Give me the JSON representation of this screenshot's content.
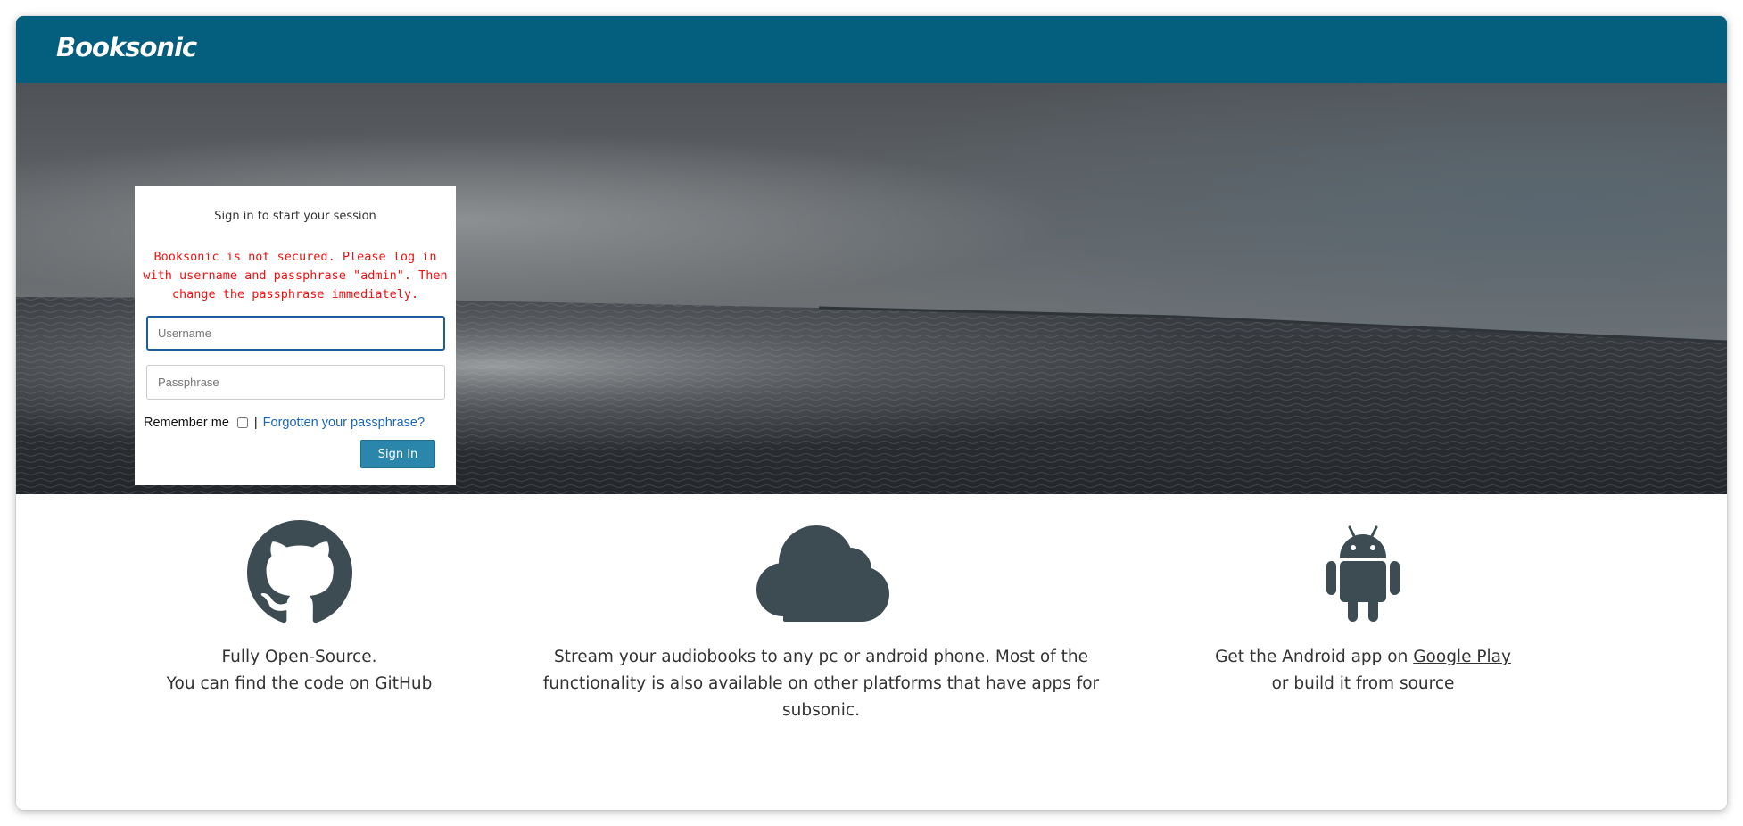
{
  "app": {
    "brand": "Booksonic",
    "colors": {
      "header": "#045f7e",
      "button": "#2a87ab",
      "warning": "#ee1111",
      "link": "#1a66b8",
      "icon": "#3d4b52"
    }
  },
  "login": {
    "title": "Sign in to start your session",
    "warning": "Booksonic is not secured. Please log in with username and passphrase \"admin\". Then change the passphrase immediately.",
    "username_placeholder": "Username",
    "username_value": "",
    "passphrase_placeholder": "Passphrase",
    "passphrase_value": "",
    "remember_label": "Remember me",
    "remember_checked": false,
    "separator": "|",
    "forgot_label": "Forgotten your passphrase?",
    "signin_label": "Sign In"
  },
  "features": [
    {
      "icon": "github-icon",
      "line1": "Fully Open-Source.",
      "line2_prefix": "You can find the code on ",
      "link": "GitHub"
    },
    {
      "icon": "cloud-icon",
      "text": "Stream your audiobooks to any pc or android phone. Most of the functionality is also available on other platforms that have apps for subsonic."
    },
    {
      "icon": "android-icon",
      "line1_prefix": "Get the Android app on ",
      "link1": "Google Play",
      "line2_prefix": "or build it from ",
      "link2": "source"
    }
  ]
}
